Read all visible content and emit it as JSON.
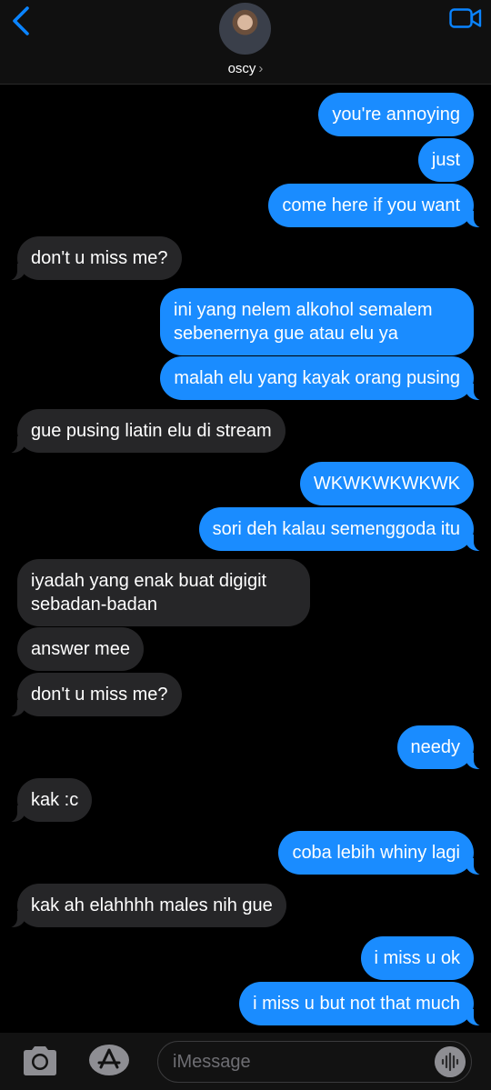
{
  "header": {
    "contact_name": "oscy",
    "chevron": "›",
    "icons": {
      "back": "chevron-left-icon",
      "video": "video-camera-icon"
    },
    "accent": "#0a84ff"
  },
  "messages": [
    {
      "from": "me",
      "text": "you're annoying"
    },
    {
      "from": "me",
      "text": "just"
    },
    {
      "from": "me",
      "text": "come here if you want"
    },
    {
      "from": "them",
      "text": "don't u miss me?"
    },
    {
      "from": "me",
      "text": "ini yang nelem alkohol semalem sebenernya gue atau elu ya"
    },
    {
      "from": "me",
      "text": "malah elu yang kayak orang pusing"
    },
    {
      "from": "them",
      "text": "gue pusing liatin elu di stream"
    },
    {
      "from": "me",
      "text": "WKWKWKWKWK"
    },
    {
      "from": "me",
      "text": "sori deh kalau semenggoda itu"
    },
    {
      "from": "them",
      "text": "iyadah yang enak buat digigit sebadan-badan"
    },
    {
      "from": "them",
      "text": "answer mee"
    },
    {
      "from": "them",
      "text": "don't u miss me?"
    },
    {
      "from": "me",
      "text": "needy"
    },
    {
      "from": "them",
      "text": "kak :c"
    },
    {
      "from": "me",
      "text": "coba lebih whiny lagi"
    },
    {
      "from": "them",
      "text": "kak ah elahhhh males nih gue"
    },
    {
      "from": "me",
      "text": "i miss u ok"
    },
    {
      "from": "me",
      "text": "i miss u but not that much"
    }
  ],
  "colors": {
    "sent_bubble": "#1a8cff",
    "received_bubble": "#262628",
    "background": "#000000"
  },
  "input_bar": {
    "placeholder": "iMessage",
    "icons": {
      "camera": "camera-icon",
      "apps": "app-store-icon",
      "audio": "audio-waveform-icon"
    }
  }
}
